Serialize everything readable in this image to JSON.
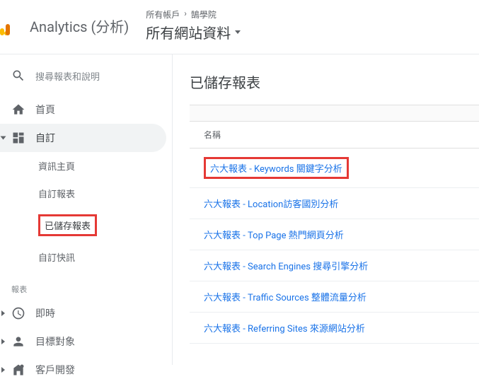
{
  "header": {
    "product_name": "Analytics (分析)",
    "breadcrumb_all_accounts": "所有帳戶",
    "breadcrumb_separator": "›",
    "breadcrumb_property": "鵠學院",
    "view_name": "所有網站資料"
  },
  "sidebar": {
    "search_placeholder": "搜尋報表和說明",
    "home": "首頁",
    "custom": "自訂",
    "custom_children": {
      "dashboards": "資訊主頁",
      "custom_reports": "自訂報表",
      "saved_reports": "已儲存報表",
      "custom_alerts": "自訂快訊"
    },
    "reports_section_label": "報表",
    "realtime": "即時",
    "audience": "目標對象",
    "acquisition": "客戶開發"
  },
  "main": {
    "title": "已儲存報表",
    "column_name": "名稱",
    "reports": [
      "六大報表 - Keywords 關鍵字分析",
      "六大報表 - Location訪客國別分析",
      "六大報表 - Top Page 熱門網頁分析",
      "六大報表 - Search Engines 搜尋引擎分析",
      "六大報表 - Traffic Sources 整體流量分析",
      "六大報表 - Referring Sites 來源網站分析"
    ]
  }
}
